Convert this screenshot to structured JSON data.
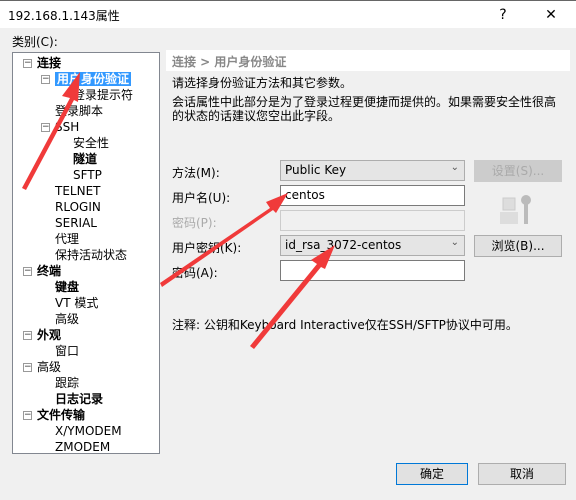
{
  "window": {
    "title": "192.168.1.143属性",
    "help": "?",
    "close": "✕"
  },
  "category_label": "类别(C):",
  "tree": [
    {
      "label": "连接",
      "level": 0,
      "bold": true,
      "expand": true
    },
    {
      "label": "用户身份验证",
      "level": 1,
      "selected": true,
      "bold": true,
      "expand": true
    },
    {
      "label": "登录提示符",
      "level": 2
    },
    {
      "label": "登录脚本",
      "level": 1
    },
    {
      "label": "SSH",
      "level": 1,
      "expand": true
    },
    {
      "label": "安全性",
      "level": 2
    },
    {
      "label": "隧道",
      "level": 2,
      "bold": true
    },
    {
      "label": "SFTP",
      "level": 2
    },
    {
      "label": "TELNET",
      "level": 1
    },
    {
      "label": "RLOGIN",
      "level": 1
    },
    {
      "label": "SERIAL",
      "level": 1
    },
    {
      "label": "代理",
      "level": 1
    },
    {
      "label": "保持活动状态",
      "level": 1
    },
    {
      "label": "终端",
      "level": 0,
      "bold": true,
      "expand": true
    },
    {
      "label": "键盘",
      "level": 1,
      "bold": true
    },
    {
      "label": "VT 模式",
      "level": 1
    },
    {
      "label": "高级",
      "level": 1
    },
    {
      "label": "外观",
      "level": 0,
      "bold": true,
      "expand": true
    },
    {
      "label": "窗口",
      "level": 1
    },
    {
      "label": "高级",
      "level": 0,
      "expand": true
    },
    {
      "label": "跟踪",
      "level": 1
    },
    {
      "label": "日志记录",
      "level": 1,
      "bold": true
    },
    {
      "label": "文件传输",
      "level": 0,
      "bold": true,
      "expand": true
    },
    {
      "label": "X/YMODEM",
      "level": 1
    },
    {
      "label": "ZMODEM",
      "level": 1
    }
  ],
  "panel": {
    "breadcrumb": "连接 > 用户身份验证",
    "desc1": "请选择身份验证方法和其它参数。",
    "desc2": "会话属性中此部分是为了登录过程更便捷而提供的。如果需要安全性很高",
    "desc3": "的状态的话建议您空出此字段。",
    "method_label": "方法(M):",
    "method_value": "Public Key",
    "settings_button": "设置(S)...",
    "username_label": "用户名(U):",
    "username_value": "centos",
    "password_label": "密码(P):",
    "userkey_label": "用户密钥(K):",
    "userkey_value": "id_rsa_3072-centos",
    "browse_button": "浏览(B)...",
    "passphrase_label": "密码(A):",
    "passphrase_value": "",
    "note": "注释: 公钥和Keyboard Interactive仅在SSH/SFTP协议中可用。"
  },
  "footer": {
    "ok": "确定",
    "cancel": "取消"
  },
  "colors": {
    "selection": "#3399ff",
    "annotation_arrow": "#f03a3a"
  }
}
